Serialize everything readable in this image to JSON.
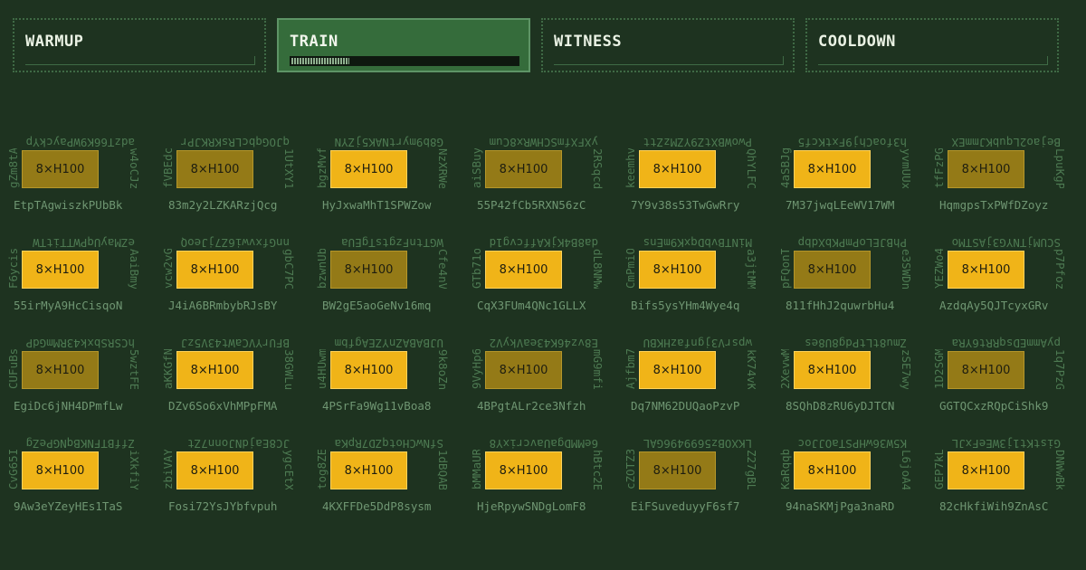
{
  "phases": [
    {
      "label": "WARMUP",
      "active": false
    },
    {
      "label": "TRAIN",
      "active": true,
      "progress": 0.25
    },
    {
      "label": "WITNESS",
      "active": false
    },
    {
      "label": "COOLDOWN",
      "active": false
    }
  ],
  "colors": {
    "background": "#1e3320",
    "active_phase": "#356c3b",
    "gpu_on": "#f0b418",
    "gpu_off": "#947a17"
  },
  "grid": [
    [
      {
        "top": "adzT66K9WPayckYp",
        "left": "gZm8tA",
        "right": "w4oCJz",
        "bottom": "EtpTAgwiszkPUbBk",
        "gpu": "8×H100",
        "active": false
      },
      {
        "top": "qJOGqbcLRsKRKJPr",
        "left": "fVBEdc",
        "right": "1UtXY1",
        "bottom": "83m2y2LZKARzjQcg",
        "gpu": "8×H100",
        "active": false
      },
      {
        "top": "G8b9myrtNAK5jZYN",
        "left": "bgzMvf",
        "right": "NzXRWe",
        "bottom": "HyJxwaMhT1SPWZow",
        "gpu": "8×H100",
        "active": true
      },
      {
        "top": "yXFXfmSCHWRx8Cum",
        "left": "aiSBuy",
        "right": "2RSqcd",
        "bottom": "55P42fCb5RXN56zC",
        "gpu": "8×H100",
        "active": false
      },
      {
        "top": "PwoWBXtZ9YZMzZtt",
        "left": "keemhv",
        "right": "QhYLFC",
        "bottom": "7Y9v38s53TwGwRry",
        "gpu": "8×H100",
        "active": true
      },
      {
        "top": "h3foaChj9FxtKcf5",
        "left": "4aSBJg",
        "right": "yvmUUx",
        "bottom": "7M37jwqLEeWV17WM",
        "gpu": "8×H100",
        "active": true
      },
      {
        "top": "Bejao2LqubKJmmEX",
        "left": "tfFzPG",
        "right": "LpuKgP",
        "bottom": "HqmgpsTxPWfDZoyz",
        "gpu": "8×H100",
        "active": false
      }
    ],
    [
      {
        "top": "eZMayUqPWTTitTW",
        "left": "F6ycis",
        "right": "AaiBmy",
        "bottom": "55irMyA9HcCisqoN",
        "gpu": "8×H100",
        "active": true
      },
      {
        "top": "nnGfxvwi6Z7jJeoQ",
        "left": "vcw2vG",
        "right": "gbC7PC",
        "bottom": "J4iA6BRmbybRJsBY",
        "gpu": "8×H100",
        "active": true
      },
      {
        "top": "WGTtnFzgtsTgEUa",
        "left": "bzwnUb",
        "right": "Cfe4nV",
        "bottom": "BW2gE5aoGeNv16mq",
        "gpu": "8×H100",
        "active": false
      },
      {
        "top": "da8B4KjKAffcvg1d",
        "left": "GTb71o",
        "right": "dL8NMw",
        "bottom": "CqX3FUm4QNc1GLLX",
        "gpu": "8×H100",
        "active": true
      },
      {
        "top": "MiNTBvbDqxK9mEns",
        "left": "CmPmiO",
        "right": "a3jtMM",
        "bottom": "Bifs5ysYHm4Wye4q",
        "gpu": "8×H100",
        "active": true
      },
      {
        "top": "PhBJELoPmPKbXdbp",
        "left": "pFQonT",
        "right": "e3SWDn",
        "bottom": "811fHhJ2quwrbHu4",
        "gpu": "8×H100",
        "active": false
      },
      {
        "top": "SCUMjTNYG3jASTMo",
        "left": "YEZWo4",
        "right": "p7Pfoz",
        "bottom": "AzdqAy5QJTcyxGRv",
        "gpu": "8×H100",
        "active": true
      }
    ],
    [
      {
        "top": "hCSRSbxk43RMmGdP",
        "left": "CUFuBs",
        "right": "5wztFE",
        "bottom": "EgiDc6jNH4DPmfLw",
        "gpu": "8×H100",
        "active": false
      },
      {
        "top": "BFUrYVCaWt43V5zJ",
        "left": "aKKGfN",
        "right": "38GWLu",
        "bottom": "DZv6So6xVhMPpFMA",
        "gpu": "8×H100",
        "active": true
      },
      {
        "top": "UJBABAZnYZEAgfbm",
        "left": "u4HUwm",
        "right": "9k8oZn",
        "bottom": "4PSrFa9Wg11vBoa8",
        "gpu": "8×H100",
        "active": true
      },
      {
        "top": "E8vz46K43eaVkyV2",
        "left": "9VyHp6",
        "right": "mG9mfi",
        "bottom": "4BPgtALr2ce3Nfzh",
        "gpu": "8×H100",
        "active": false
      },
      {
        "top": "wpsrV3jgnfazHKBU",
        "left": "Ajfbm7",
        "right": "kK74vK",
        "bottom": "Dq7NM62DUQaoPzvP",
        "gpu": "8×H100",
        "active": true
      },
      {
        "top": "Zmu8tLtPdg8U8es",
        "left": "2XevwM",
        "right": "zSE7wy",
        "bottom": "8SQhD8zRU6yDJTCN",
        "gpu": "8×H100",
        "active": true
      },
      {
        "top": "pyAmmEDsqRRt6YRa",
        "left": "1D2SGM",
        "right": "1q7PzG",
        "bottom": "GGTQCxzRQpCiShk9",
        "gpu": "8×H100",
        "active": false
      }
    ],
    [
      {
        "top": "ZffBTFNKBqNGPeZg",
        "left": "CvG65I",
        "right": "iXkfiY",
        "bottom": "9Aw3eYZeyHEs1TaS",
        "gpu": "8×H100",
        "active": true
      },
      {
        "top": "JC8EajdNJonn7Zt",
        "left": "zbiVAY",
        "right": "ygcEtX",
        "bottom": "Fosi72YsJYbfvpuh",
        "gpu": "8×H100",
        "active": true
      },
      {
        "top": "SfNwCHotqZD7RpKa",
        "left": "tog8ZE",
        "right": "1dBQAB",
        "bottom": "4KXFFDe5DdP8sysm",
        "gpu": "8×H100",
        "active": true
      },
      {
        "top": "6eMMDgaUavcrixY8",
        "left": "bMMaUR",
        "right": "hBtc2E",
        "bottom": "HjeRpywSNDgLomF8",
        "gpu": "8×H100",
        "active": true
      },
      {
        "top": "LKXOBz5699496GAL",
        "left": "cZOTZ3",
        "right": "Z27gBL",
        "bottom": "EiFSuveduyyF6sf7",
        "gpu": "8×H100",
        "active": false
      },
      {
        "top": "K5W36wHPSTaOJJoc",
        "left": "KaRqqb",
        "right": "L6joA4",
        "bottom": "94naSKMjPga3naRD",
        "gpu": "8×H100",
        "active": true
      },
      {
        "top": "GistKt1j3WEeFxJL",
        "left": "GEP7kL",
        "right": "DNWwBk",
        "bottom": "82cHkfiWih9ZnAsC",
        "gpu": "8×H100",
        "active": true
      }
    ]
  ]
}
